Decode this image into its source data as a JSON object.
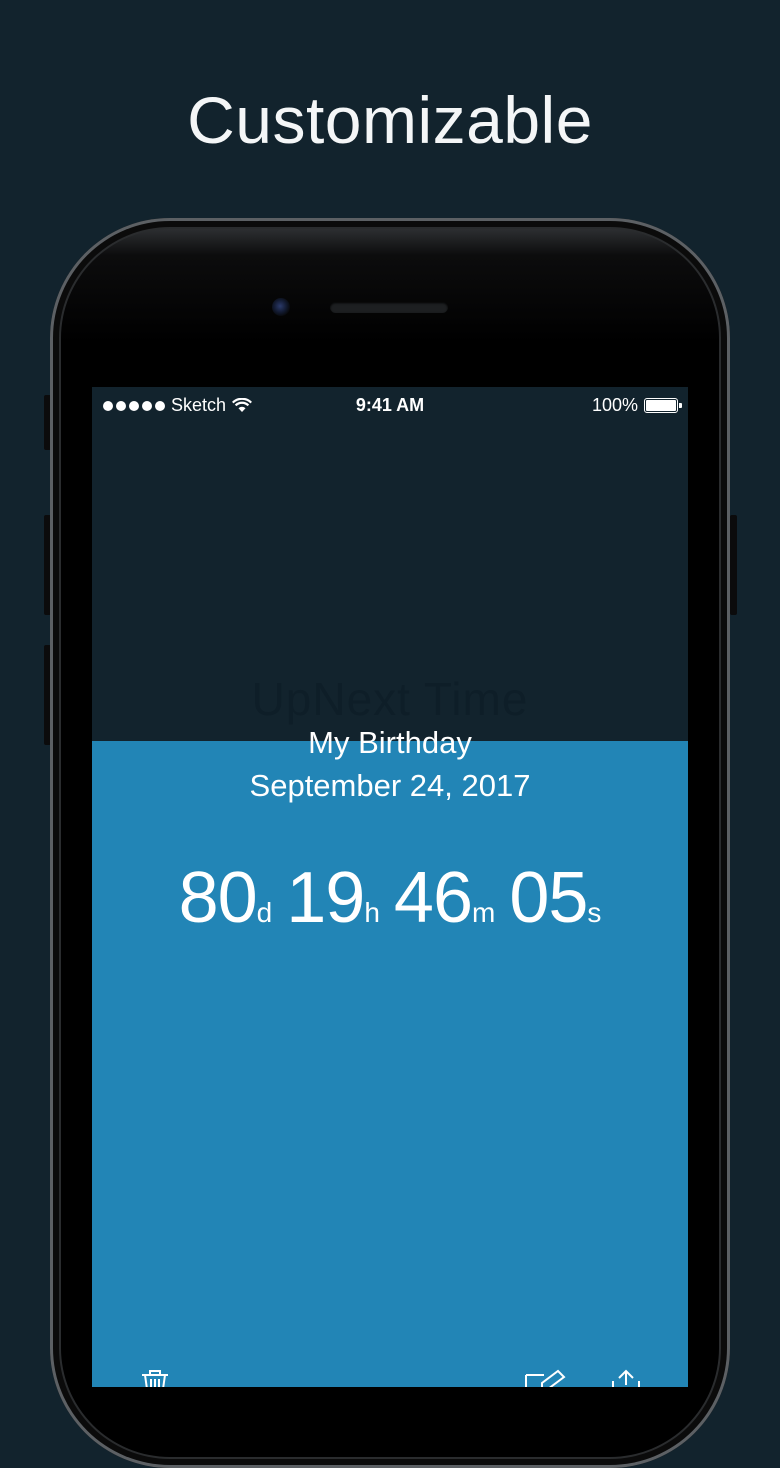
{
  "headline": "Customizable",
  "status_bar": {
    "carrier": "Sketch",
    "time": "9:41 AM",
    "battery": "100%"
  },
  "event": {
    "ghost_text": "UpNext Time",
    "title": "My Birthday",
    "date": "September 24, 2017"
  },
  "countdown": {
    "days": "80",
    "days_unit": "d",
    "hours": "19",
    "hours_unit": "h",
    "minutes": "46",
    "minutes_unit": "m",
    "seconds": "05",
    "seconds_unit": "s"
  },
  "toolbar": {
    "left_icon": "trash-icon",
    "right_icons": [
      "edit-icon",
      "share-icon"
    ]
  },
  "colors": {
    "background": "#12232d",
    "accent": "#2285b6"
  }
}
